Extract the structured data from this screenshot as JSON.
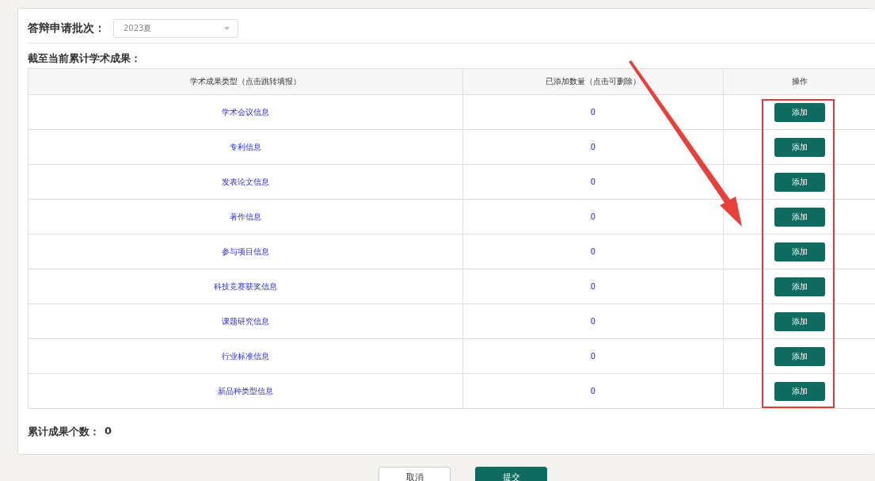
{
  "batch": {
    "label": "答辩申请批次：",
    "value": "2023夏"
  },
  "section_title": "截至当前累计学术成果：",
  "table": {
    "columns": [
      "学术成果类型（点击跳转填报）",
      "已添加数量（点击可删除）",
      "操作"
    ],
    "rows": [
      {
        "category": "学术会议信息",
        "count": "0",
        "action": "添加"
      },
      {
        "category": "专利信息",
        "count": "0",
        "action": "添加"
      },
      {
        "category": "发表论文信息",
        "count": "0",
        "action": "添加"
      },
      {
        "category": "著作信息",
        "count": "0",
        "action": "添加"
      },
      {
        "category": "参与项目信息",
        "count": "0",
        "action": "添加"
      },
      {
        "category": "科技竞赛获奖信息",
        "count": "0",
        "action": "添加"
      },
      {
        "category": "课题研究信息",
        "count": "0",
        "action": "添加"
      },
      {
        "category": "行业标准信息",
        "count": "0",
        "action": "添加"
      },
      {
        "category": "新品种类型信息",
        "count": "0",
        "action": "添加"
      }
    ]
  },
  "total": {
    "label": "累计成果个数：",
    "value": "0"
  },
  "buttons": [
    {
      "label": "取消",
      "kind": "secondary"
    },
    {
      "label": "提交",
      "kind": "primary"
    }
  ]
}
